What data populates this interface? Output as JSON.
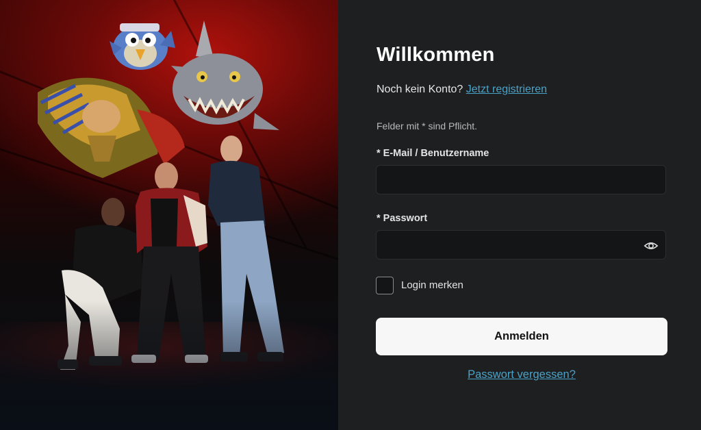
{
  "login": {
    "title": "Willkommen",
    "no_account_text": "Noch kein Konto?",
    "register_link": "Jetzt registrieren",
    "required_note": "Felder mit * sind Pflicht.",
    "email_label": "* E-Mail / Benutzername",
    "email_value": "",
    "password_label": "* Passwort",
    "password_value": "",
    "remember_label": "Login merken",
    "remember_checked": false,
    "submit_label": "Anmelden",
    "forgot_link": "Passwort vergessen?"
  },
  "icons": {
    "password_toggle": "eye-icon",
    "remember": "checkbox"
  },
  "colors": {
    "panel_background": "#1e1f21",
    "input_background": "#141516",
    "link": "#4aa3c9",
    "submit_background": "#f7f7f7",
    "hero_accent": "#b0120c"
  }
}
